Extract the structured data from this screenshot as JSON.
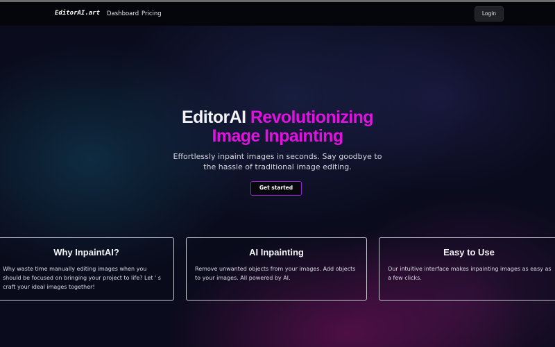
{
  "nav": {
    "logo": "EditorAI.art",
    "links": [
      "Dashboard",
      "Pricing"
    ],
    "login_label": "Login"
  },
  "hero": {
    "title_white": "EditorAI",
    "title_pink_1": "Revolutionizing",
    "title_pink_2": "Image Inpainting",
    "subtitle": "Effortlessly inpaint images in seconds. Say goodbye to the hassle of traditional image editing.",
    "cta_label": "Get started"
  },
  "cards": [
    {
      "title": "Why InpaintAI?",
      "body": "Why waste time manually editing images when you should be focused on bringing your project to life? Let ' s craft your ideal images together!"
    },
    {
      "title": "AI Inpainting",
      "body": "Remove unwanted objects from your images. Add objects to your images. All powered by AI."
    },
    {
      "title": "Easy to Use",
      "body": "Our intuitive interface makes inpainting images as easy as a few clicks."
    }
  ],
  "colors": {
    "accent_pink": "#e012e0",
    "cta_border": "#9b1fd6",
    "nav_bg": "#05060b"
  }
}
